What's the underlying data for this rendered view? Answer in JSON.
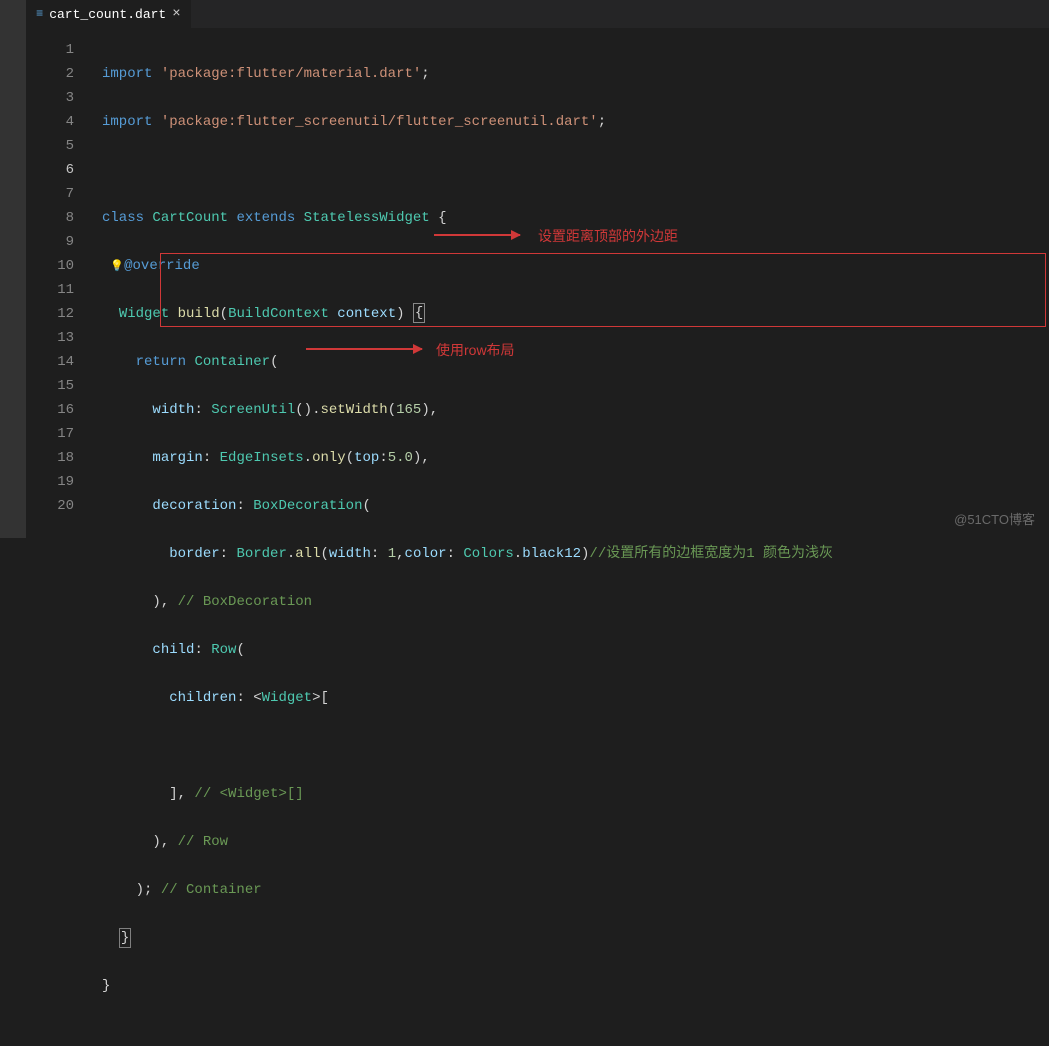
{
  "tab": {
    "filename": "cart_count.dart",
    "icon_glyph": "≡"
  },
  "gutter": {
    "lines": [
      "1",
      "2",
      "3",
      "4",
      "5",
      "6",
      "7",
      "8",
      "9",
      "10",
      "11",
      "12",
      "13",
      "14",
      "15",
      "16",
      "17",
      "18",
      "19",
      "20"
    ],
    "current_line": 6
  },
  "code": {
    "l1": {
      "kw1": "import",
      "str": "'package:flutter/material.dart'",
      "end": ";"
    },
    "l2": {
      "kw1": "import",
      "str": "'package:flutter_screenutil/flutter_screenutil.dart'",
      "end": ";"
    },
    "l4": {
      "kw_class": "class",
      "name": "CartCount",
      "kw_ext": "extends",
      "base": "StatelessWidget",
      "brace": " {"
    },
    "l5": {
      "bulb": "💡",
      "dec": "@override"
    },
    "l6": {
      "ret": "Widget",
      "fn": "build",
      "lp": "(",
      "ptype": "BuildContext",
      "pname": " context",
      "rp": ") ",
      "brace": "{"
    },
    "l7": {
      "kw": "return",
      "cls": "Container",
      "end": "("
    },
    "l8": {
      "lab": "width",
      "col": ": ",
      "cls": "ScreenUtil",
      "call": "().",
      "fn": "setWidth",
      "lp": "(",
      "num": "165",
      "rp": "),"
    },
    "l9": {
      "lab": "margin",
      "col": ": ",
      "cls": "EdgeInsets",
      "dot": ".",
      "fn": "only",
      "lp": "(",
      "arg": "top",
      "col2": ":",
      "num": "5.0",
      "rp": "),"
    },
    "l10": {
      "lab": "decoration",
      "col": ": ",
      "cls": "BoxDecoration",
      "end": "("
    },
    "l11": {
      "lab": "border",
      "col": ": ",
      "cls": "Border",
      "dot": ".",
      "fn": "all",
      "lp": "(",
      "a1": "width",
      "c1": ": ",
      "n1": "1",
      "sep": ",",
      "a2": "color",
      "c2": ": ",
      "cls2": "Colors",
      "dot2": ".",
      "val": "black12",
      "rp": ")",
      "cmt": "//设置所有的边框宽度为1 颜色为浅灰"
    },
    "l12": {
      "rp": "),",
      "cmt": " // BoxDecoration"
    },
    "l13": {
      "lab": "child",
      "col": ": ",
      "cls": "Row",
      "end": "("
    },
    "l14": {
      "lab": "children",
      "col": ": <",
      "cls": "Widget",
      "end": ">["
    },
    "l16": {
      "rp": "],",
      "cmt": " // <Widget>[]"
    },
    "l17": {
      "rp": "),",
      "cmt": " // Row"
    },
    "l18": {
      "rp": ");",
      "cmt": " // Container"
    },
    "l19": {
      "brace": "}"
    },
    "l20": {
      "brace": "}"
    }
  },
  "annotations": {
    "a1": "设置距离顶部的外边距",
    "a2": "使用row布局"
  },
  "watermark": "@51CTO博客"
}
